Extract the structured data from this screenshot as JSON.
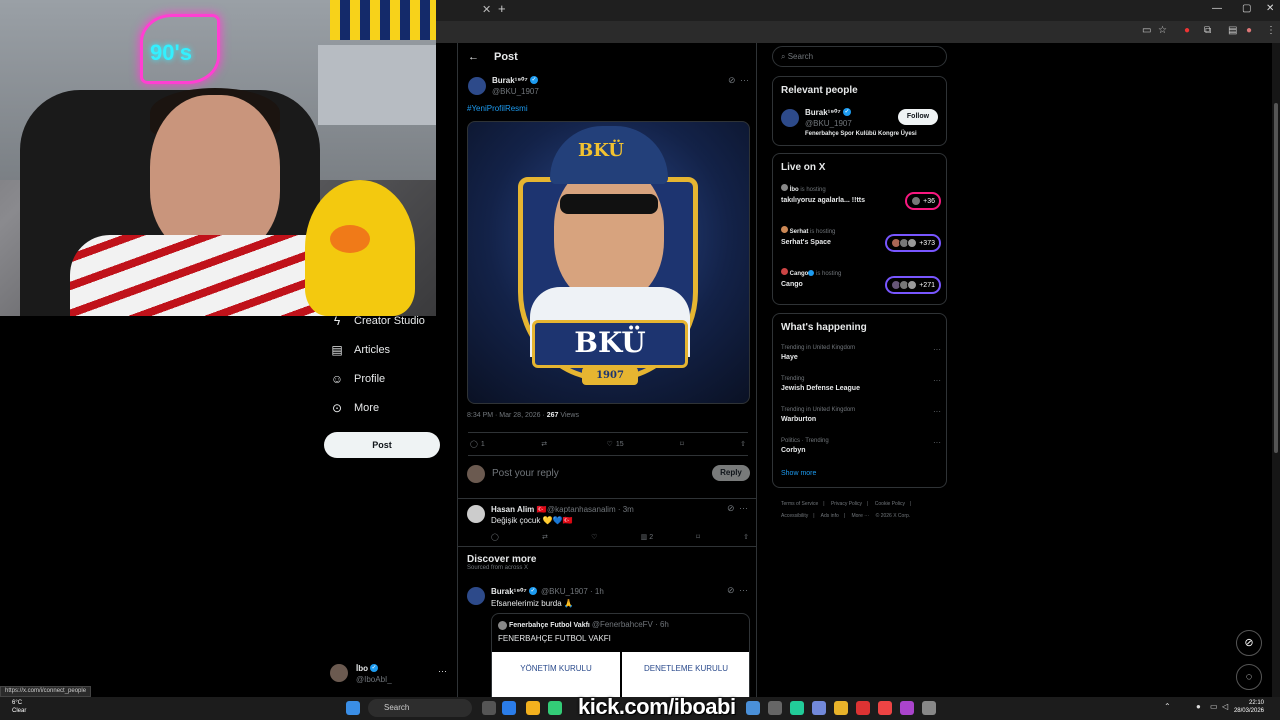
{
  "sidebar": {
    "items": [
      {
        "label": "Creator Studio",
        "icon": "lightning-icon"
      },
      {
        "label": "Articles",
        "icon": "article-icon"
      },
      {
        "label": "Profile",
        "icon": "person-icon"
      },
      {
        "label": "More",
        "icon": "more-circle-icon"
      }
    ],
    "post_label": "Post",
    "me": {
      "name": "İbo",
      "handle": "@IboAbI_"
    }
  },
  "header": {
    "title": "Post",
    "back": "←"
  },
  "post": {
    "author_name": "Burak¹⁹⁰⁷",
    "author_handle": "@BKU_1907",
    "hashtag": "#YeniProfilResmi",
    "image_cap_text": "BKÜ",
    "image_banner_text": "BKÜ",
    "image_year": "1907",
    "timestamp": "8:34 PM · Mar 28, 2026 · ",
    "views_count": "267",
    "views_label": " Views",
    "replies": "1",
    "reposts": "",
    "likes": "15",
    "reply_placeholder": "Post your reply",
    "reply_button": "Reply"
  },
  "comment": {
    "name": "Hasan Alim 🇹🇷",
    "handle": "@kaptanhasanalim · 3m",
    "text": "Değişik çocuk 💛💙🇹🇷",
    "likes": "",
    "views": "2"
  },
  "discover": {
    "title": "Discover more",
    "subtitle": "Sourced from across X"
  },
  "tweet2": {
    "name": "Burak¹⁹⁰⁷",
    "handle": "@BKU_1907 · 1h",
    "text": "Efsanelerimiz burda 🙏",
    "quote_name": "Fenerbahçe Futbol Vakfı",
    "quote_handle": "@FenerbahceFV · 6h",
    "quote_text": "FENERBAHÇE FUTBOL VAKFI",
    "quote_img1": "YÖNETİM KURULU",
    "quote_img2": "DENETLEME KURULU"
  },
  "right": {
    "search_placeholder": "Search",
    "relevant_title": "Relevant people",
    "relevant": {
      "name": "Burak¹⁹⁰⁷",
      "handle": "@BKU_1907",
      "bio": "Fenerbahçe Spor Kulübü Kongre Üyesi",
      "follow": "Follow"
    },
    "live_title": "Live on X",
    "live": [
      {
        "host": "İbo",
        "hosting": " is hosting",
        "title": "takılıyoruz agalarla... !!tts",
        "count": "+36"
      },
      {
        "host": "Serhat",
        "hosting": " is hosting",
        "title": "Serhat's Space",
        "count": "+373"
      },
      {
        "host": "Cango",
        "hosting": " is hosting",
        "title": "Cango",
        "count": "+271"
      }
    ],
    "happening_title": "What's happening",
    "trends": [
      {
        "context": "Trending in United Kingdom",
        "title": "Haye"
      },
      {
        "context": "Trending",
        "title": "Jewish Defense League"
      },
      {
        "context": "Trending in United Kingdom",
        "title": "Warburton"
      },
      {
        "context": "Politics · Trending",
        "title": "Corbyn"
      }
    ],
    "show_more": "Show more",
    "footer": [
      "Terms of Service",
      "|",
      "Privacy Policy",
      "|",
      "Cookie Policy",
      "|",
      "Accessibility",
      "|",
      "Ads info",
      "|",
      "More ···",
      "© 2026 X Corp."
    ]
  },
  "browser": {
    "status_url": "https://x.com/i/connect_people"
  },
  "taskbar": {
    "temp": "6°C",
    "weather": "Clear",
    "search": "Search",
    "time": "22:10",
    "date": "28/03/2026"
  },
  "overlay": {
    "kick": "kick.com/iboabi"
  },
  "webcam": {
    "neon": "90's"
  }
}
